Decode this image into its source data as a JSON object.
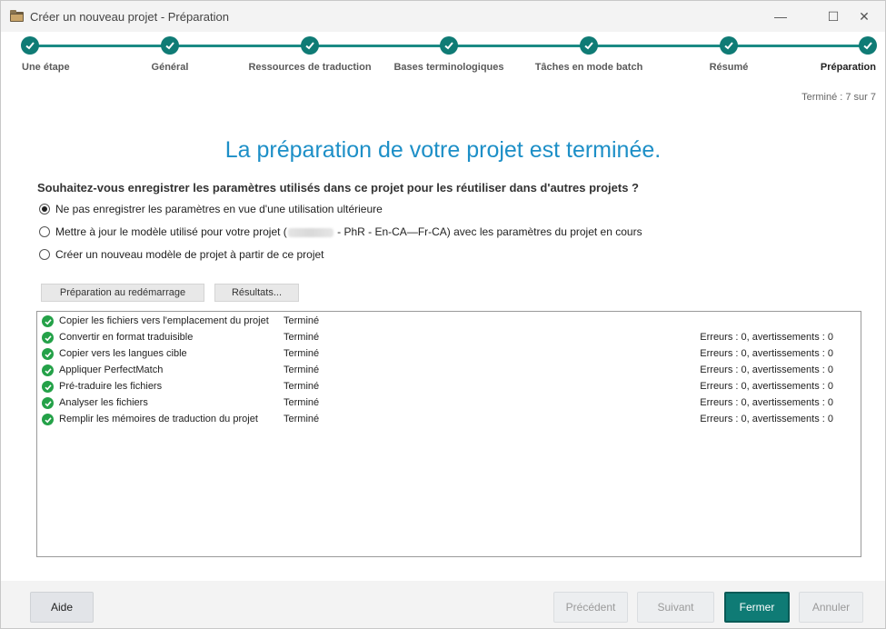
{
  "window": {
    "title": "Créer un nouveau projet - Préparation",
    "minimize_glyph": "—",
    "maximize_glyph": "☐",
    "close_glyph": "✕"
  },
  "steps": [
    {
      "label": "Une étape",
      "status": "done"
    },
    {
      "label": "Général",
      "status": "done"
    },
    {
      "label": "Ressources de traduction",
      "status": "done"
    },
    {
      "label": "Bases terminologiques",
      "status": "done"
    },
    {
      "label": "Tâches en mode batch",
      "status": "done"
    },
    {
      "label": "Résumé",
      "status": "done"
    },
    {
      "label": "Préparation",
      "status": "done"
    }
  ],
  "step_count": "Terminé : 7 sur 7",
  "heading": "La préparation de votre projet est terminée.",
  "question": "Souhaitez-vous enregistrer les paramètres utilisés dans ce projet pour les réutiliser dans d'autres projets ?",
  "options": {
    "opt1": {
      "label": "Ne pas enregistrer les paramètres en vue d'une utilisation ultérieure",
      "checked": true
    },
    "opt2": {
      "label_before": "Mettre à jour le modèle utilisé pour votre projet (",
      "label_after": " - PhR - En-CA—Fr-CA) avec les paramètres du projet en cours",
      "checked": false
    },
    "opt3": {
      "label": "Créer un nouveau modèle de projet à partir de ce projet",
      "checked": false
    }
  },
  "buttons": {
    "restart_prep": "Préparation au redémarrage",
    "results": "Résultats..."
  },
  "tasks": [
    {
      "name": "Copier les fichiers vers l'emplacement du projet",
      "status": "Terminé",
      "errors": ""
    },
    {
      "name": "Convertir en format traduisible",
      "status": "Terminé",
      "errors": "Erreurs : 0, avertissements : 0"
    },
    {
      "name": "Copier vers les langues cible",
      "status": "Terminé",
      "errors": "Erreurs : 0, avertissements : 0"
    },
    {
      "name": "Appliquer PerfectMatch",
      "status": "Terminé",
      "errors": "Erreurs : 0, avertissements : 0"
    },
    {
      "name": "Pré-traduire les fichiers",
      "status": "Terminé",
      "errors": "Erreurs : 0, avertissements : 0"
    },
    {
      "name": "Analyser les fichiers",
      "status": "Terminé",
      "errors": "Erreurs : 0, avertissements : 0"
    },
    {
      "name": "Remplir les mémoires de traduction du projet",
      "status": "Terminé",
      "errors": "Erreurs : 0, avertissements : 0"
    }
  ],
  "footer": {
    "help": "Aide",
    "previous": "Précédent",
    "next": "Suivant",
    "close": "Fermer",
    "cancel": "Annuler"
  },
  "colors": {
    "accent": "#0f7b75",
    "heading": "#1d8fc7",
    "success": "#24a148"
  }
}
